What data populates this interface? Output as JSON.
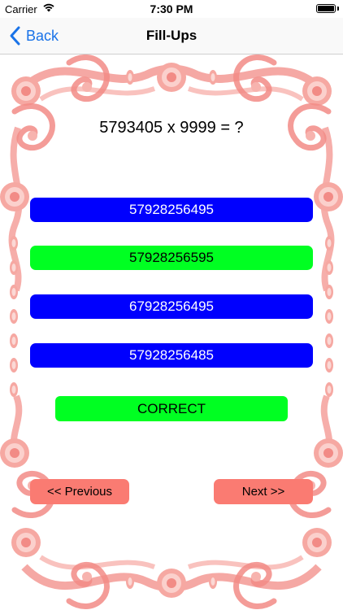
{
  "status_bar": {
    "carrier": "Carrier",
    "time": "7:30 PM",
    "icons": [
      "wifi-icon",
      "battery-icon"
    ]
  },
  "nav": {
    "back_label": "Back",
    "title": "Fill-Ups"
  },
  "question": "5793405 x 9999 = ?",
  "options": [
    {
      "label": "57928256495",
      "color": "#0000fe"
    },
    {
      "label": "57928256595",
      "color": "#00ff22"
    },
    {
      "label": "67928256495",
      "color": "#0000fe"
    },
    {
      "label": "57928256485",
      "color": "#0000fe"
    }
  ],
  "result": {
    "label": "CORRECT",
    "color": "#00ff22"
  },
  "buttons": {
    "previous": "<< Previous",
    "next": "Next >>"
  },
  "colors": {
    "accent": "#1a73e8",
    "frame": "#f28b86",
    "nav_buttons": "#fa7b72"
  }
}
